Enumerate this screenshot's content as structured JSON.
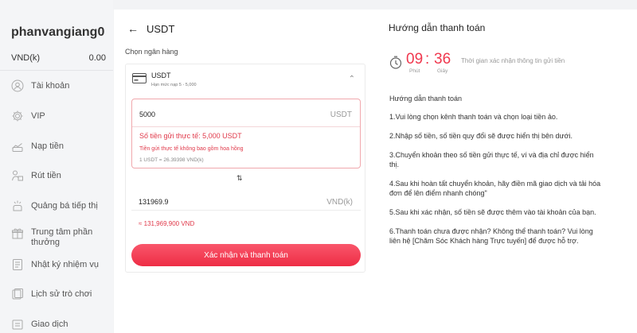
{
  "sidebar": {
    "username": "phanvangiang0",
    "balance_label": "VND(k)",
    "balance_value": "0.00",
    "items": [
      {
        "label": "Tài khoản",
        "icon": "user-icon"
      },
      {
        "label": "VIP",
        "icon": "gear-icon"
      },
      {
        "label": "Nạp tiền",
        "icon": "deposit-icon"
      },
      {
        "label": "Rút tiền",
        "icon": "withdraw-icon"
      },
      {
        "label": "Quảng bá tiếp thị",
        "icon": "promote-icon"
      },
      {
        "label": "Trung tâm phần thưởng",
        "icon": "gift-icon"
      },
      {
        "label": "Nhật ký nhiệm vụ",
        "icon": "task-log-icon"
      },
      {
        "label": "Lịch sử trò chơi",
        "icon": "history-icon"
      },
      {
        "label": "Giao dịch",
        "icon": "transaction-icon"
      }
    ]
  },
  "header": {
    "back_icon": "back-arrow-icon",
    "title": "USDT"
  },
  "form": {
    "bank_label": "Chọn ngân hàng",
    "channel_name": "USDT",
    "channel_limit": "Hạn mức nạp 5 - 5,000",
    "amount_value": "5000",
    "amount_unit": "USDT",
    "actual_amount_text": "Số tiền gửi thực tế: 5,000 USDT",
    "fee_note": "Tiền gửi thực tế không bao gồm hoa hồng",
    "rate_note": "1 USDT = 26.39398 VND(k)",
    "vnd_value": "131969.9",
    "vnd_unit": "VND(k)",
    "vnd_result": "≈ 131,969,900 VND",
    "confirm_label": "Xác nhận và thanh toán"
  },
  "guide": {
    "title": "Hướng dẫn thanh toán",
    "timer_minutes": "09",
    "timer_colon": ":",
    "timer_seconds": "36",
    "minutes_label": "Phút",
    "seconds_label": "Giây",
    "timer_text": "Thời gian xác nhận thông tin gửi tiền",
    "heading": "Hướng dẫn thanh toán",
    "steps": [
      "1.Vui lòng chọn kênh thanh toán và chọn loại tiền ảo.",
      "2.Nhập số tiền, số tiền quy đổi sẽ được hiển thị bên dưới.",
      "3.Chuyển khoản theo số tiền gửi thực tế, ví và địa chỉ được hiển thị.",
      "4.Sau khi hoàn tất chuyển khoản, hãy điền mã giao dịch và tải hóa đơn để lên điểm nhanh chóng\"",
      "5.Sau khi xác nhận, số tiền sẽ được thêm vào tài khoản của bạn.",
      "6.Thanh toán chưa được nhận? Không thể thanh toán? Vui lòng liên hệ [Chăm Sóc Khách hàng Trực tuyến] để được hỗ trợ."
    ]
  },
  "colors": {
    "accent": "#ee2d45",
    "error_text": "#e0394a"
  }
}
